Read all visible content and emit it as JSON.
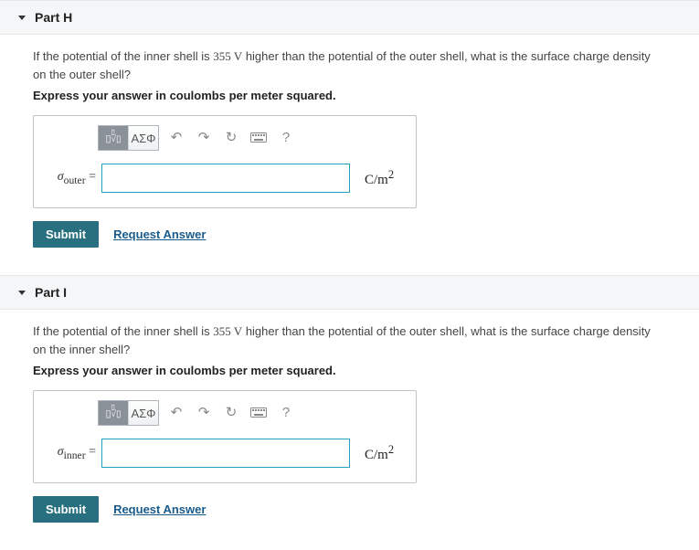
{
  "parts": [
    {
      "header": "Part H",
      "prompt_pre": "If the potential of the inner shell is ",
      "prompt_val": "355 V",
      "prompt_post": " higher than the potential of the outer shell, what is the surface charge density on the outer shell?",
      "instruction": "Express your answer in coulombs per meter squared.",
      "var_letter": "σ",
      "var_sub": "outer",
      "unit_html": "C/m²",
      "input_value": ""
    },
    {
      "header": "Part I",
      "prompt_pre": "If the potential of the inner shell is ",
      "prompt_val": "355 V",
      "prompt_post": " higher than the potential of the outer shell, what is the surface charge density on the inner shell?",
      "instruction": "Express your answer in coulombs per meter squared.",
      "var_letter": "σ",
      "var_sub": "inner",
      "unit_html": "C/m²",
      "input_value": ""
    }
  ],
  "toolbar": {
    "template_label": "template",
    "greek_label": "ΑΣΦ"
  },
  "actions": {
    "submit": "Submit",
    "request": "Request Answer"
  }
}
